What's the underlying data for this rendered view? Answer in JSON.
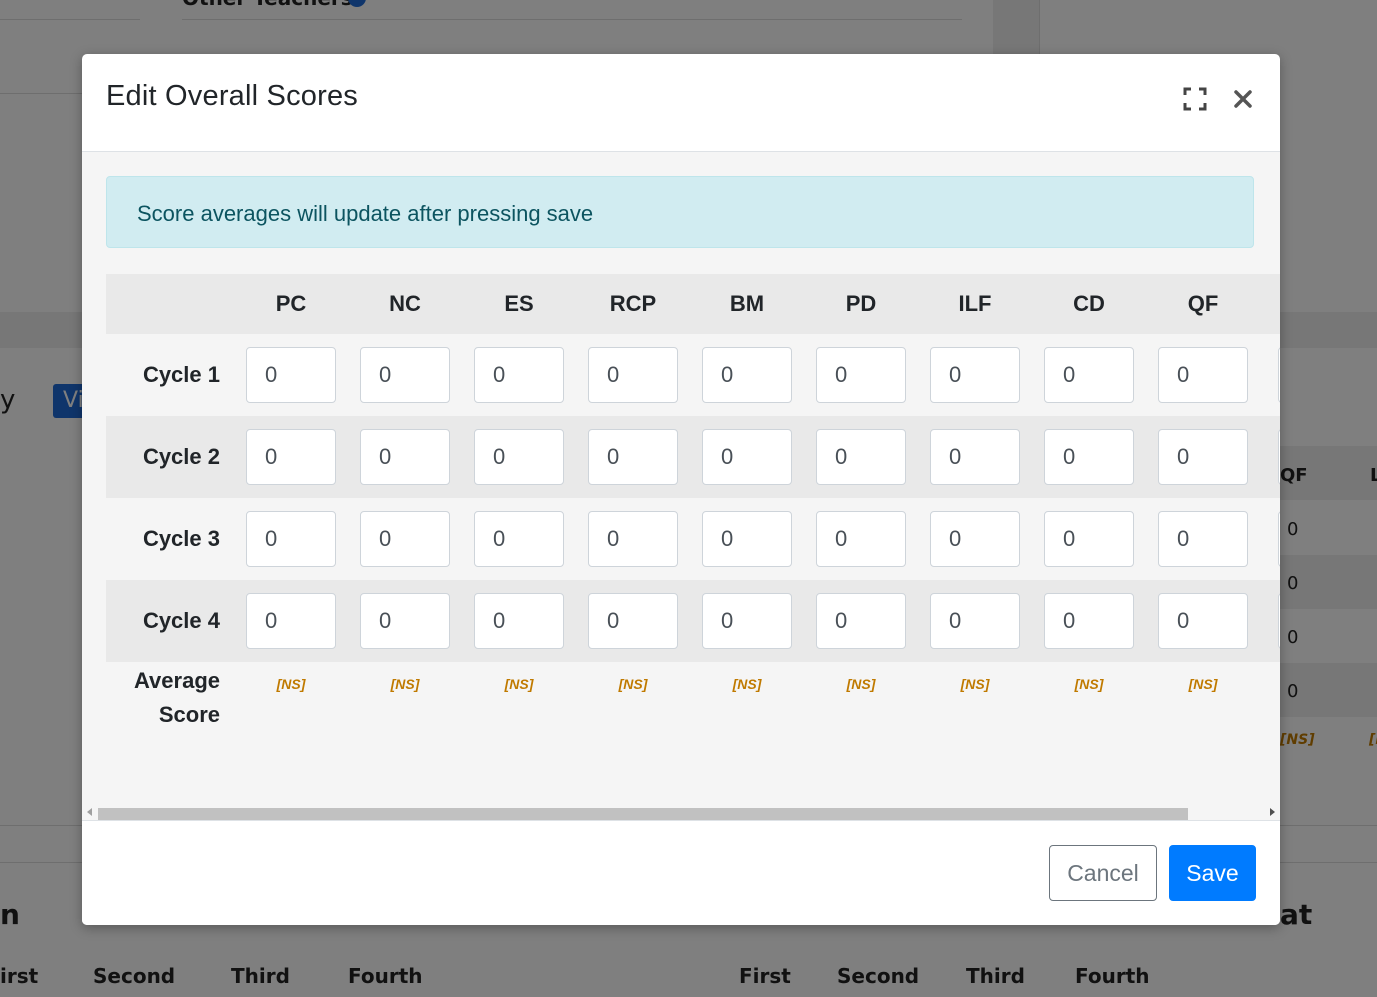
{
  "background": {
    "other_teachers_label": "Other Teachers",
    "side_letter": "y",
    "view_button_label": "Vi",
    "table_headers": [
      "QF",
      "L"
    ],
    "table_values": [
      "0",
      "0",
      "0",
      "0"
    ],
    "table_ns": [
      "[NS]",
      "[I"
    ],
    "left_section_title_fragment": "n",
    "right_section_title_fragment": "at",
    "left_columns": [
      "irst",
      "Second",
      "Third",
      "Fourth"
    ],
    "right_columns": [
      "First",
      "Second",
      "Third",
      "Fourth"
    ]
  },
  "modal": {
    "title": "Edit Overall Scores",
    "alert": "Score averages will update after pressing save",
    "columns": [
      "PC",
      "NC",
      "ES",
      "RCP",
      "BM",
      "PD",
      "ILF",
      "CD",
      "QF"
    ],
    "rows": [
      {
        "label": "Cycle 1",
        "values": [
          "0",
          "0",
          "0",
          "0",
          "0",
          "0",
          "0",
          "0",
          "0"
        ]
      },
      {
        "label": "Cycle 2",
        "values": [
          "0",
          "0",
          "0",
          "0",
          "0",
          "0",
          "0",
          "0",
          "0"
        ]
      },
      {
        "label": "Cycle 3",
        "values": [
          "0",
          "0",
          "0",
          "0",
          "0",
          "0",
          "0",
          "0",
          "0"
        ]
      },
      {
        "label": "Cycle 4",
        "values": [
          "0",
          "0",
          "0",
          "0",
          "0",
          "0",
          "0",
          "0",
          "0"
        ]
      }
    ],
    "average_label_line1": "Average",
    "average_label_line2": "Score",
    "averages": [
      "[NS]",
      "[NS]",
      "[NS]",
      "[NS]",
      "[NS]",
      "[NS]",
      "[NS]",
      "[NS]",
      "[NS]"
    ],
    "cancel_label": "Cancel",
    "save_label": "Save"
  },
  "colors": {
    "primary": "#007bff",
    "alert_bg": "#d1ecf1",
    "alert_text": "#0c5460",
    "ns_text": "#c07a00"
  }
}
